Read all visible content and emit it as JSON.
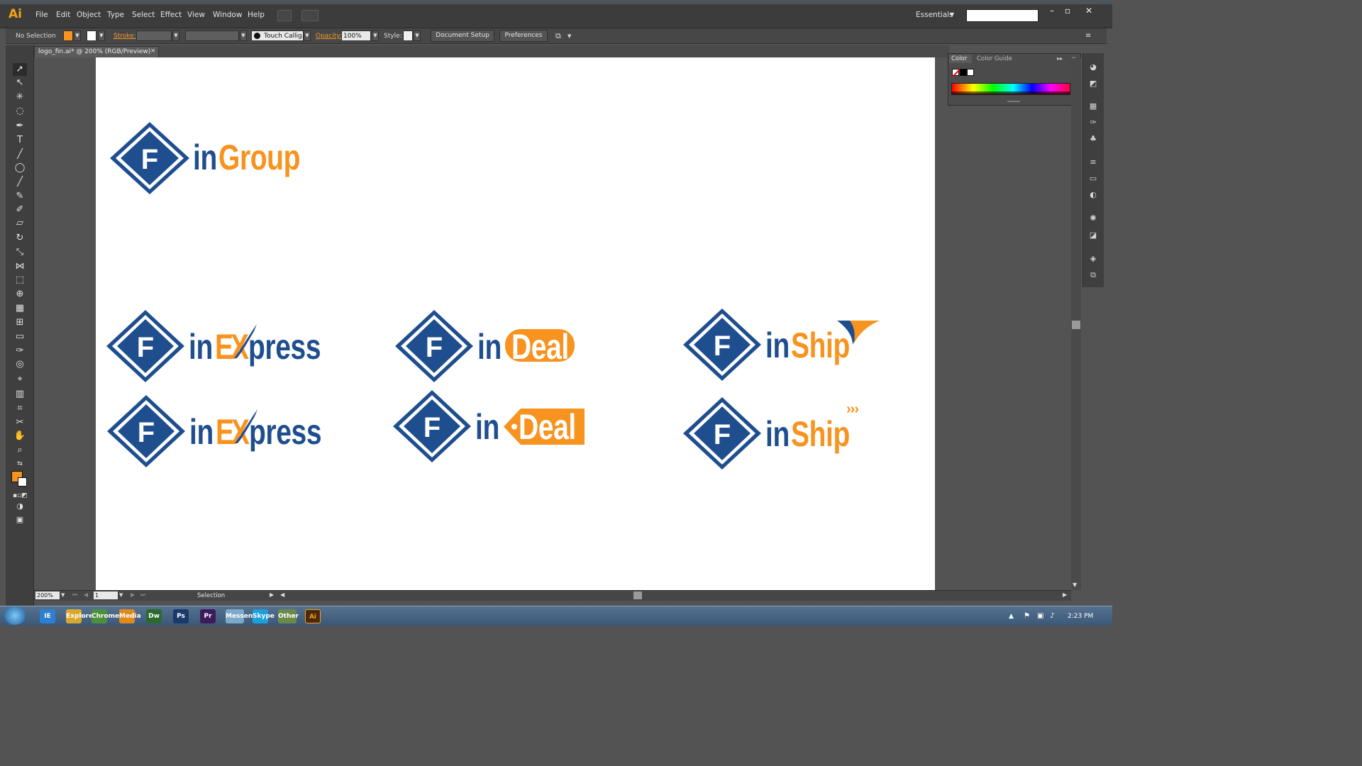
{
  "app": {
    "logo": "Ai",
    "workspace": "Essentials"
  },
  "menu": [
    "File",
    "Edit",
    "Object",
    "Type",
    "Select",
    "Effect",
    "View",
    "Window",
    "Help"
  ],
  "control_bar": {
    "selection": "No Selection",
    "stroke_label": "Stroke:",
    "brush": "Touch Callig...",
    "opacity_label": "Opacity:",
    "opacity_value": "100%",
    "style_label": "Style:",
    "document_setup": "Document Setup",
    "preferences": "Preferences"
  },
  "document_tab": {
    "title": "logo_fin.ai* @ 200% (RGB/Preview)",
    "close": "×"
  },
  "panels": {
    "color_tab": "Color",
    "color_guide_tab": "Color Guide"
  },
  "status_bar": {
    "zoom": "200%",
    "page": "1",
    "tool": "Selection"
  },
  "taskbar": {
    "time": "2:23 PM",
    "apps": [
      "IE",
      "Explorer",
      "Chrome",
      "Media",
      "Dw",
      "Ps",
      "Pr",
      "Messenger",
      "Skype",
      "Other",
      "Ai"
    ]
  },
  "logos": {
    "prefix": "in",
    "monogram": "F",
    "group": "Group",
    "express_e": "E",
    "express_x": "X",
    "express_rest": "press",
    "deal": "Deal",
    "ship": "Ship",
    "chevrons": "›››"
  },
  "colors": {
    "brand_blue": "#1f4e8f",
    "brand_orange": "#f7931e"
  }
}
